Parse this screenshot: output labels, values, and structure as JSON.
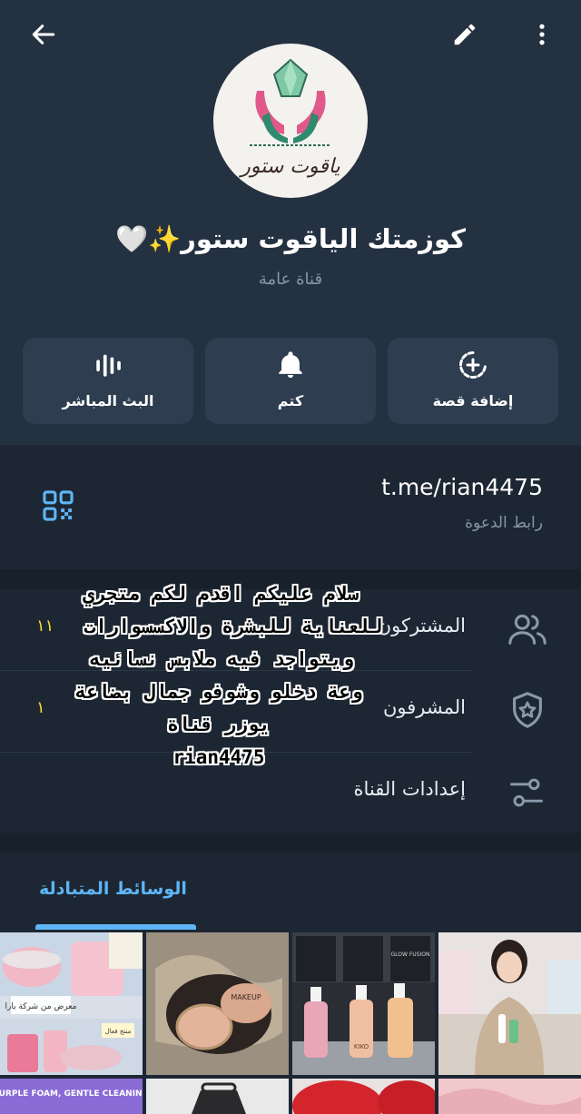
{
  "header": {
    "channel_name": "كوزمتك الياقوت ستور✨🤍",
    "channel_type": "قناة عامة",
    "logo_text": "ياقوت ستور"
  },
  "actions": [
    {
      "label": "إضافة قصة",
      "icon": "add-story-icon"
    },
    {
      "label": "كتم",
      "icon": "bell-icon"
    },
    {
      "label": "البث المباشر",
      "icon": "live-stream-icon"
    }
  ],
  "invite": {
    "url": "t.me/rian4475",
    "caption": "رابط الدعوة"
  },
  "info": {
    "subscribers_label": "المشتركون",
    "subscribers_count": "١١",
    "admins_label": "المشرفون",
    "admins_count": "١",
    "settings_label": "إعدادات القناة"
  },
  "overlay_text": {
    "lines": [
      "سلام عليكم اقدم لكم متجري",
      "للعناية للبشرة والاكسسوارات",
      "ويتواجد فيه ملابس نسائيه",
      "وعة دخلو وشوفو جمال بضاعة",
      "يوزر قناة",
      "rian4475"
    ]
  },
  "media": {
    "tab_label": "الوسائط المتبادلة",
    "thumb_texts": {
      "t1_sticker": "معرض من شركة بارا",
      "t1_badge": "منتج فعال",
      "t2_product": "MAKEUP",
      "t3_brand": "KIKO",
      "t3_line": "GLOW FUSION",
      "r2_banner": "PURPLE FOAM, GENTLE CLEANING"
    }
  },
  "colors": {
    "header_bg": "#243141",
    "page_bg": "#1d2733",
    "accent": "#5eb5f7",
    "button_bg": "#2e3d4f",
    "muted_text": "#8496a8"
  }
}
